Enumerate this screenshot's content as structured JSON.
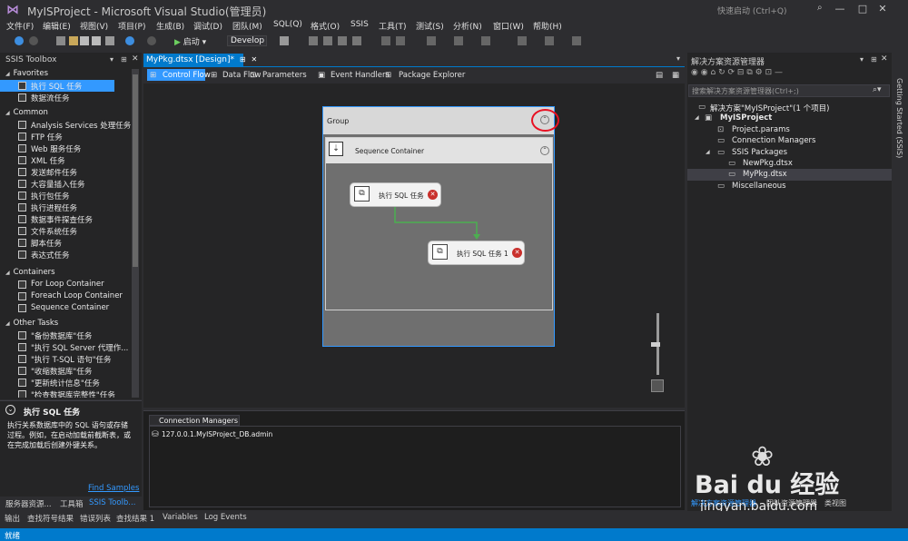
{
  "window": {
    "title": "MyISProject - Microsoft Visual Studio(管理员)",
    "quick_launch": "快速启动 (Ctrl+Q)",
    "minimize": "—",
    "maximize": "□",
    "close": "✕"
  },
  "menu": [
    "文件(F)",
    "编辑(E)",
    "视图(V)",
    "项目(P)",
    "生成(B)",
    "调试(D)",
    "团队(M)",
    "SQL(Q)",
    "格式(O)",
    "SSIS",
    "工具(T)",
    "测试(S)",
    "分析(N)",
    "窗口(W)",
    "帮助(H)"
  ],
  "toolbar": {
    "start_label": "启动",
    "config": "Develop"
  },
  "toolbox": {
    "title": "SSIS Toolbox",
    "categories": {
      "favorites": "Favorites",
      "common": "Common",
      "containers": "Containers",
      "other": "Other Tasks"
    },
    "favorites": [
      "执行 SQL 任务",
      "数据流任务"
    ],
    "common": [
      "Analysis Services 处理任务",
      "FTP 任务",
      "Web 服务任务",
      "XML 任务",
      "发送邮件任务",
      "大容量插入任务",
      "执行包任务",
      "执行进程任务",
      "数据事件探查任务",
      "文件系统任务",
      "脚本任务",
      "表达式任务"
    ],
    "containers": [
      "For Loop Container",
      "Foreach Loop Container",
      "Sequence Container"
    ],
    "other": [
      "\"备份数据库\"任务",
      "\"执行 SQL Server 代理作...",
      "\"执行 T-SQL 语句\"任务",
      "\"收缩数据库\"任务",
      "\"更新统计信息\"任务",
      "\"检查数据库完整性\"任务"
    ]
  },
  "description": {
    "title": "执行 SQL 任务",
    "lines": [
      "执行关系数据库中的 SQL 语句或存储",
      "过程。例如，在启动加载前截断表，或",
      "在完成加载后创建外键关系。"
    ],
    "link": "Find Samples"
  },
  "left_tabs": [
    "服务器资源...",
    "工具箱",
    "SSIS Toolb..."
  ],
  "document": {
    "tab_label": "MyPkg.dtsx [Design]*",
    "pin": "⊞",
    "close": "✕"
  },
  "designer_tabs": [
    "Control Flow",
    "Data Flow",
    "Parameters",
    "Event Handlers",
    "Package Explorer"
  ],
  "canvas": {
    "group_label": "Group",
    "container_label": "Sequence Container",
    "task1": "执行 SQL 任务",
    "task2": "执行 SQL 任务 1"
  },
  "connections": {
    "tab": "Connection Managers",
    "items": [
      "127.0.0.1.MyISProject_DB.admin"
    ]
  },
  "solution_explorer": {
    "title": "解决方案资源管理器",
    "search_placeholder": "搜索解决方案资源管理器(Ctrl+;)",
    "root": "解决方案\"MyISProject\"(1 个项目)",
    "project": "MyISProject",
    "items": [
      "Project.params",
      "Connection Managers",
      "SSIS Packages",
      "NewPkg.dtsx",
      "MyPkg.dtsx",
      "Miscellaneous"
    ],
    "bottom_tabs": [
      "解决方案资源管理器",
      "团队资源管理器",
      "类视图"
    ]
  },
  "right_strip": "Getting Started (SSIS)",
  "bottom_tabs": [
    "输出",
    "查找符号结果",
    "错误列表",
    "查找结果 1",
    "Variables",
    "Log Events"
  ],
  "status": "就绪",
  "watermark": {
    "brand": "Bai du 经验",
    "url": "jingyan.baidu.com"
  },
  "colors": {
    "accent": "#007acc",
    "highlight": "#e81123",
    "task_error": "#c9302c",
    "connector": "#4caf50"
  }
}
